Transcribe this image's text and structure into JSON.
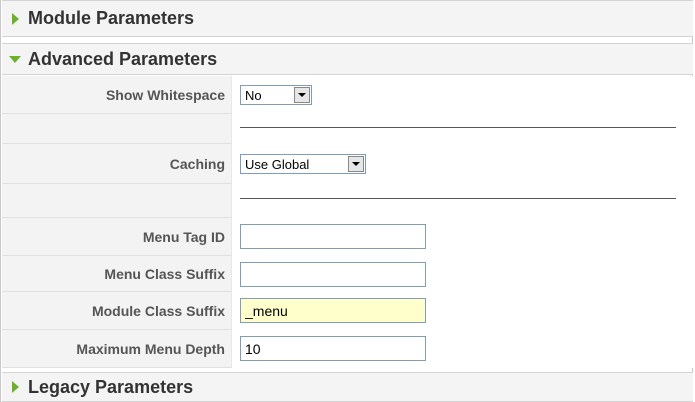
{
  "panels": {
    "module": {
      "title": "Module Parameters",
      "expanded": false
    },
    "advanced": {
      "title": "Advanced Parameters",
      "expanded": true
    },
    "legacy": {
      "title": "Legacy Parameters",
      "expanded": false
    }
  },
  "fields": {
    "show_whitespace": {
      "label": "Show Whitespace",
      "value": "No"
    },
    "caching": {
      "label": "Caching",
      "value": "Use Global"
    },
    "menu_tag_id": {
      "label": "Menu Tag ID",
      "value": ""
    },
    "menu_class_suffix": {
      "label": "Menu Class Suffix",
      "value": ""
    },
    "module_class_suffix": {
      "label": "Module Class Suffix",
      "value": "_menu"
    },
    "max_menu_depth": {
      "label": "Maximum Menu Depth",
      "value": "10"
    }
  },
  "colors": {
    "toggle_arrow": "#6bb22a",
    "highlight_field": "#ffffcc"
  }
}
